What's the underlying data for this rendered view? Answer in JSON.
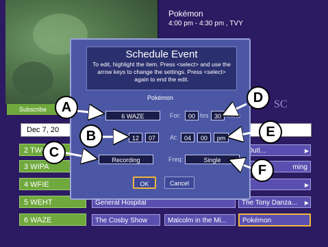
{
  "program": {
    "title": "Pokémon",
    "time": "4:00 pm - 4:30 pm , TVY"
  },
  "subscribe_label": "Subscribe",
  "logo_text": "SC",
  "guide": {
    "date": "Dec 7, 20",
    "channels": [
      "2 TWC",
      "3 WIPA",
      "4 WFIE",
      "5 WEHT",
      "6 WAZE"
    ],
    "row_cells": [
      [
        {
          "text": "n Outl...",
          "arrow": "▶"
        }
      ],
      [
        {
          "text": "ming",
          "arrow": ""
        }
      ],
      [
        {
          "text": "",
          "arrow": "▶"
        }
      ],
      [
        {
          "text": "General Hospital",
          "arrow": ""
        },
        {
          "text": "The Tony Danza...",
          "arrow": "▶"
        }
      ],
      [
        {
          "text": "The Cosby Show",
          "arrow": ""
        },
        {
          "text": "Malcolm in the Mi...",
          "arrow": ""
        },
        {
          "text": "Pokémon",
          "arrow": ""
        }
      ]
    ]
  },
  "dialog": {
    "title": "Schedule Event",
    "instructions": "To edit, highlight the item.  Press <select> and use the arrow keys to change the settings. Press <select> again to end the edit.",
    "show": "Pokémon",
    "channel_label": "Ch:",
    "channel_value": "6 WAZE",
    "for_label": "For:",
    "duration_hours": "00",
    "hrs_label": "hrs",
    "duration_mins": "30",
    "mins_label": "mins",
    "date_month": "12",
    "date_day": "07",
    "at_label": "At:",
    "time_hour": "04",
    "time_min": "00",
    "ampm": "pm",
    "type_value": "Recording",
    "freq_label": "Freq:",
    "freq_value": "Single",
    "ok_label": "OK",
    "cancel_label": "Cancel"
  },
  "callouts": [
    "A",
    "B",
    "C",
    "D",
    "E",
    "F"
  ],
  "colors": {
    "background": "#2c1a63",
    "dialog": "#4b57a4",
    "channel": "#6fa83d",
    "cell": "#5a4fb0",
    "highlight": "#f3b73c"
  }
}
